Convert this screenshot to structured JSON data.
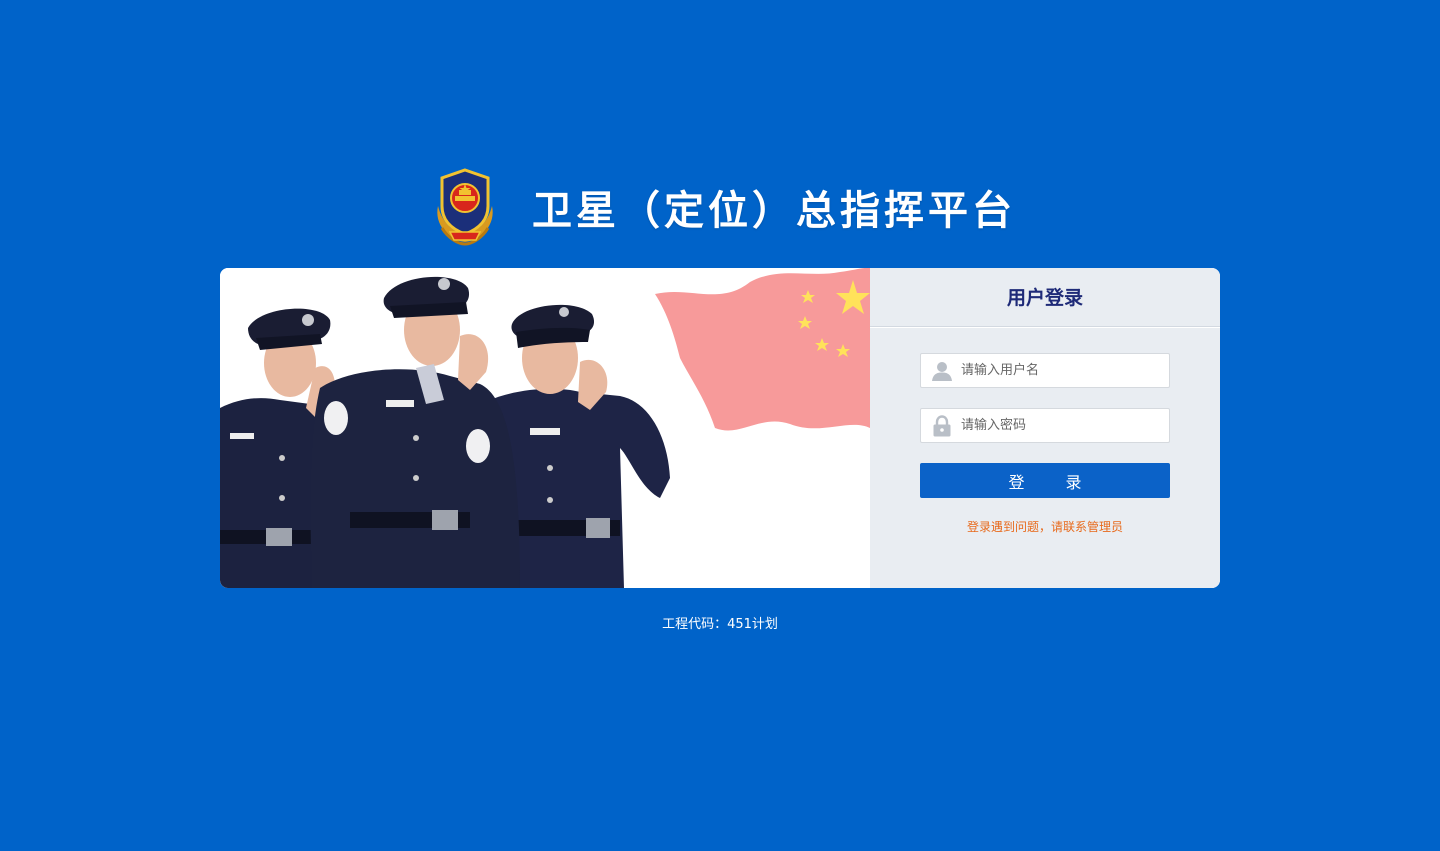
{
  "header": {
    "title": "卫星（定位）总指挥平台",
    "emblem_icon": "police-emblem-icon"
  },
  "banner": {
    "image": "saluting-police-officers-with-flag"
  },
  "login": {
    "title": "用户登录",
    "username_placeholder": "请输入用户名",
    "password_placeholder": "请输入密码",
    "submit_label": "登 录",
    "help_text": "登录遇到问题，请联系管理员",
    "user_icon": "user-icon",
    "lock_icon": "lock-icon"
  },
  "footer": {
    "project_code": "工程代码：451计划"
  },
  "colors": {
    "background": "#0063c9",
    "panel": "#e9edf2",
    "title_text": "#1e2a78",
    "button": "#0b62c8",
    "help_text": "#e86a1c",
    "flag": "#f79a9a",
    "stars": "#ffe25a"
  }
}
